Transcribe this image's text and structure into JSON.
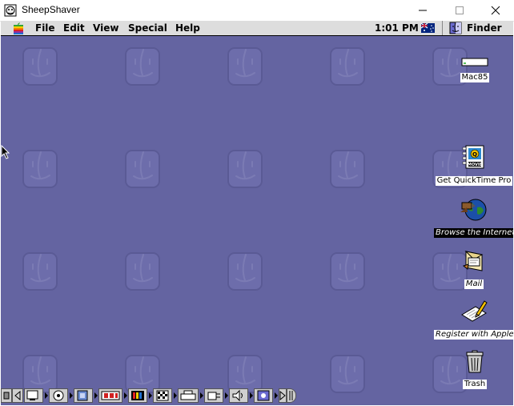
{
  "window": {
    "title": "SheepShaver",
    "minimize_icon": "minimize-icon",
    "maximize_icon": "maximize-icon",
    "close_icon": "close-icon"
  },
  "menubar": {
    "apple_icon": "apple-menu-icon",
    "items": [
      "File",
      "Edit",
      "View",
      "Special",
      "Help"
    ],
    "clock": "1:01 PM",
    "keyboard_flag_icon": "australia-flag-icon",
    "app_name": "Finder",
    "app_icon": "finder-icon"
  },
  "desktop": {
    "background_color": "#6464a1",
    "pattern_icon": "mac-os-face-logo",
    "icons": [
      {
        "label": "Mac85",
        "icon": "hard-disk-icon"
      },
      {
        "label": "Get QuickTime Pro",
        "icon": "quicktime-movie-icon"
      },
      {
        "label": "Browse the Internet",
        "icon": "globe-browser-icon",
        "selected": true
      },
      {
        "label": "Mail",
        "icon": "mail-icon"
      },
      {
        "label": "Register with Apple",
        "icon": "register-pen-icon"
      },
      {
        "label": "Trash",
        "icon": "trash-icon"
      }
    ]
  },
  "control_strip": {
    "modules": [
      "monitor-icon",
      "cd-icon",
      "file-sharing-icon",
      "memory-icon",
      "monitor-bit-depth-icon",
      "resolution-icon",
      "printer-icon",
      "remote-access-icon",
      "sound-volume-icon",
      "web-sharing-icon"
    ]
  }
}
